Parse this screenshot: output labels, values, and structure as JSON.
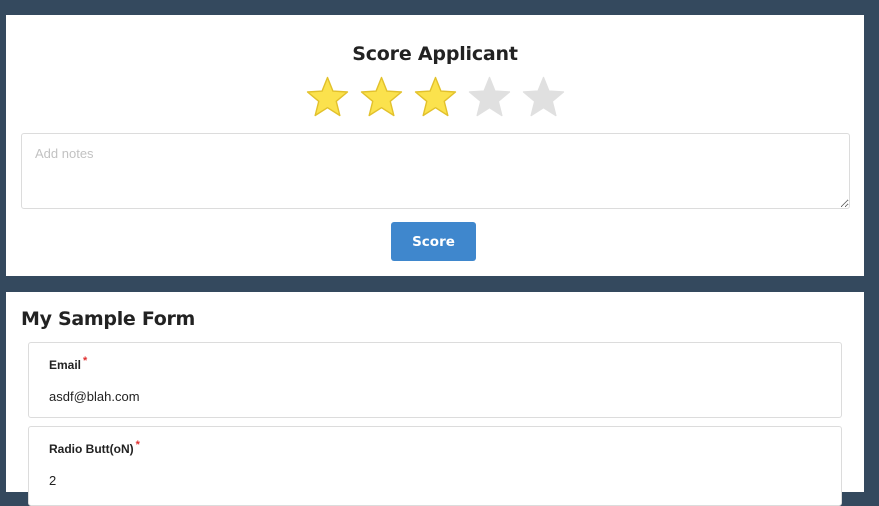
{
  "score_panel": {
    "title": "Score Applicant",
    "rating": 3,
    "max_rating": 5,
    "notes_placeholder": "Add notes",
    "notes_value": "",
    "score_button_label": "Score",
    "colors": {
      "star_filled": "#fbe24d",
      "star_filled_stroke": "#e2c12b",
      "star_empty": "#e0e0e0",
      "button": "#3f87cd"
    }
  },
  "form": {
    "title": "My Sample Form",
    "fields": [
      {
        "label": "Email",
        "required_marker": "*",
        "value": "asdf@blah.com"
      },
      {
        "label": "Radio Butt(oN)",
        "required_marker": "*",
        "value": "2"
      }
    ]
  },
  "colors": {
    "background": "#34495e",
    "card": "#ffffff",
    "required": "#e03030"
  }
}
